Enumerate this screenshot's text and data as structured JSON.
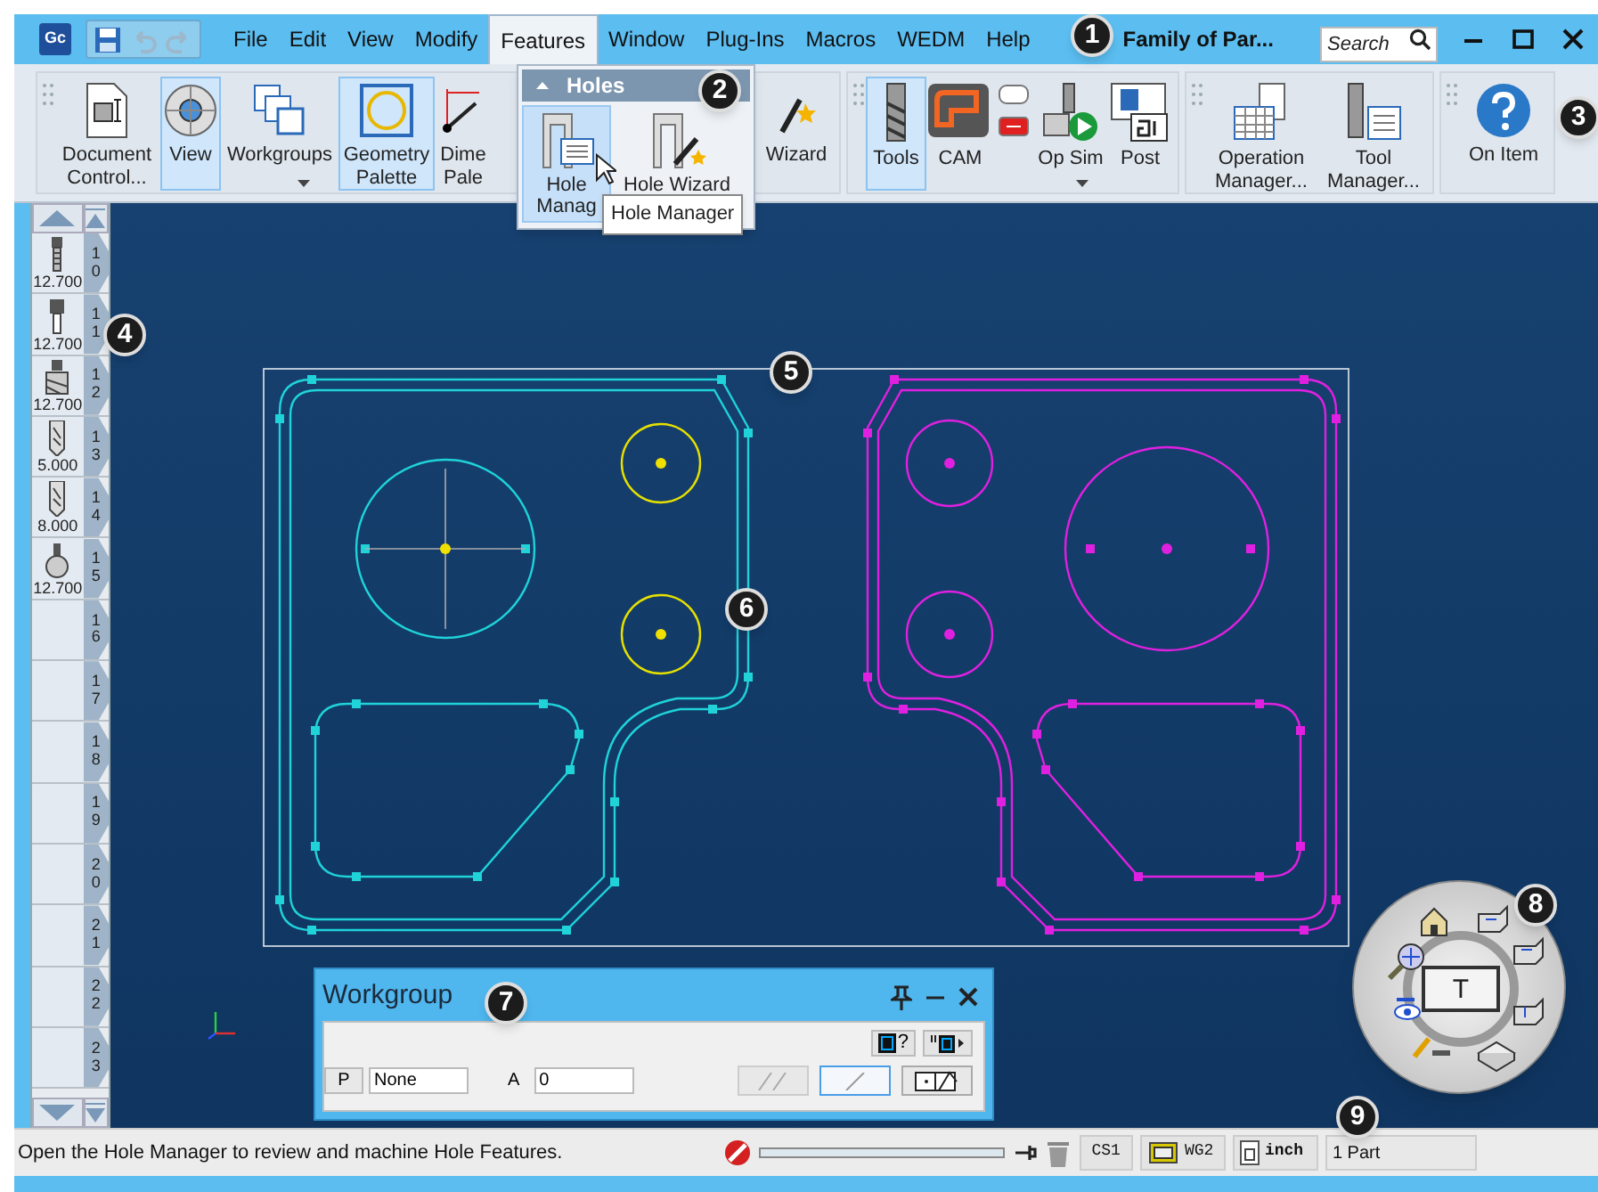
{
  "app_icon": "Gc",
  "menu": [
    {
      "label": "File",
      "selected": false
    },
    {
      "label": "Edit",
      "selected": false
    },
    {
      "label": "View",
      "selected": false
    },
    {
      "label": "Modify",
      "selected": false
    },
    {
      "label": "Features",
      "selected": true
    },
    {
      "label": "Window",
      "selected": false
    },
    {
      "label": "Plug-Ins",
      "selected": false
    },
    {
      "label": "Macros",
      "selected": false
    },
    {
      "label": "WEDM",
      "selected": false
    },
    {
      "label": "Help",
      "selected": false
    }
  ],
  "title": "Family of Par...",
  "search": {
    "placeholder": "Search"
  },
  "ribbon": [
    {
      "items": [
        {
          "kind": "document",
          "label": "Document Control...",
          "selected": false
        },
        {
          "kind": "view",
          "label": "View",
          "selected": true
        },
        {
          "kind": "workgroups",
          "label": "Workgroups",
          "selected": false
        },
        {
          "kind": "geometry",
          "label": "Geometry Palette",
          "selected": true
        },
        {
          "kind": "dimension",
          "label": "Dime Pale",
          "selected": false
        },
        {
          "kind": "wizard",
          "label": "Wizard",
          "selected": false
        }
      ]
    },
    {
      "items": [
        {
          "kind": "tools",
          "label": "Tools",
          "selected": true
        },
        {
          "kind": "cam",
          "label": "CAM",
          "selected": false
        },
        {
          "kind": "small",
          "selected": false
        },
        {
          "kind": "opsim",
          "label": "Op Sim",
          "selected": false
        },
        {
          "kind": "post",
          "label": "Post",
          "selected": false
        }
      ]
    },
    {
      "items": [
        {
          "kind": "opman",
          "label": "Operation Manager...",
          "selected": false
        },
        {
          "kind": "toolman",
          "label": "Tool Manager...",
          "selected": false
        }
      ]
    },
    {
      "items": [
        {
          "kind": "help",
          "label": "On Item",
          "selected": false
        }
      ]
    }
  ],
  "dropdown": {
    "header": "Holes",
    "items": [
      {
        "kind": "manager",
        "label": "Hole Manag",
        "selected": true
      },
      {
        "kind": "wizard",
        "label": "Hole Wizard",
        "selected": false
      }
    ],
    "tooltip": "Hole Manager"
  },
  "tool_slots": [
    {
      "number": "10",
      "size": "12.700",
      "kind": "tap"
    },
    {
      "number": "11",
      "size": "12.700",
      "kind": "endmill"
    },
    {
      "number": "12",
      "size": "12.700",
      "kind": "cutter"
    },
    {
      "number": "13",
      "size": "5.000",
      "kind": "drill"
    },
    {
      "number": "14",
      "size": "8.000",
      "kind": "drill"
    },
    {
      "number": "15",
      "size": "12.700",
      "kind": "ball"
    },
    {
      "number": "16"
    },
    {
      "number": "17"
    },
    {
      "number": "18"
    },
    {
      "number": "19"
    },
    {
      "number": "20"
    },
    {
      "number": "21"
    },
    {
      "number": "22"
    },
    {
      "number": "23"
    }
  ],
  "workgroup": {
    "title": "Workgroup",
    "help_mark": "?",
    "p_label": "P",
    "p_value": "None",
    "a_label": "A",
    "a_value": "0",
    "line_modes": [
      {
        "kind": "double",
        "selected": false
      },
      {
        "kind": "single",
        "selected": true
      }
    ]
  },
  "view_wheel": {
    "center_label": "T"
  },
  "status": {
    "message": "Open the Hole Manager to review and machine Hole Features.",
    "progress": {
      "level": 0
    },
    "cs": "CS1",
    "wg": "WG2",
    "unit": "inch",
    "parts": "1 Part"
  },
  "callouts": [
    "1",
    "2",
    "3",
    "4",
    "5",
    "6",
    "7",
    "8",
    "9"
  ]
}
